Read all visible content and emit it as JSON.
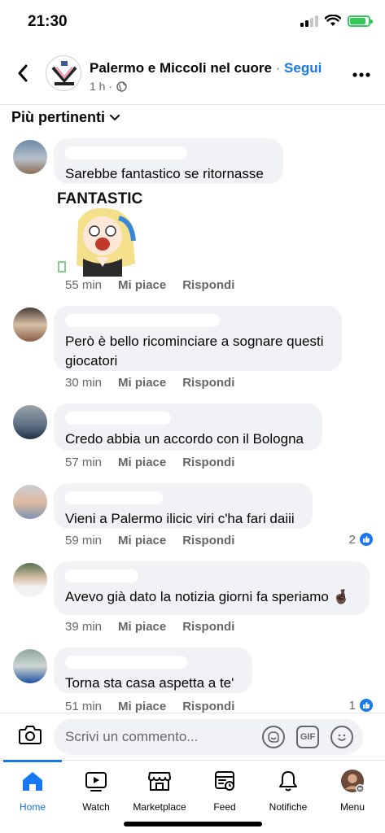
{
  "status_bar": {
    "time": "21:30",
    "icons": [
      "signal-icon",
      "wifi-icon",
      "battery-charging-icon"
    ],
    "battery_color": "#34c759",
    "battery_level": 0.85
  },
  "header": {
    "page_name": "Palermo e Miccoli nel cuore",
    "separator": " · ",
    "follow_label": "Segui",
    "post_age": "1 h ·",
    "back_icon": "chevron-left-icon",
    "more_icon": "more-dots-icon"
  },
  "sort": {
    "label": "Più pertinenti",
    "icon": "chevron-down-icon"
  },
  "comments": [
    {
      "text": "Sarebbe fantastico se ritornasse",
      "sticker_caption": "FANTASTIC",
      "time": "55 min",
      "like_label": "Mi piace",
      "reply_label": "Rispondi"
    },
    {
      "text": "Però è bello ricominciare a sognare questi giocatori",
      "time": "30 min",
      "like_label": "Mi piace",
      "reply_label": "Rispondi"
    },
    {
      "text": "Credo abbia un accordo con il Bologna",
      "time": "57 min",
      "like_label": "Mi piace",
      "reply_label": "Rispondi"
    },
    {
      "text": "Vieni a Palermo ilicic viri c'ha fari daiii",
      "time": "59 min",
      "like_label": "Mi piace",
      "reply_label": "Rispondi",
      "reaction_count": "2"
    },
    {
      "text": "Avevo già dato la notizia giorni fa speriamo 🤞🏿",
      "time": "39 min",
      "like_label": "Mi piace",
      "reply_label": "Rispondi"
    },
    {
      "text": "Torna sta casa aspetta a te'",
      "time": "51 min",
      "like_label": "Mi piace",
      "reply_label": "Rispondi",
      "reaction_count": "1"
    }
  ],
  "composer": {
    "placeholder": "Scrivi un commento...",
    "gif_label": "GIF",
    "icons": [
      "camera-icon",
      "sticker-icon",
      "gif-icon",
      "emoji-icon"
    ]
  },
  "tabbar": {
    "active_color": "#1877f2",
    "tabs": [
      {
        "label": "Home",
        "icon": "home-icon"
      },
      {
        "label": "Watch",
        "icon": "watch-icon"
      },
      {
        "label": "Marketplace",
        "icon": "marketplace-icon"
      },
      {
        "label": "Feed",
        "icon": "feed-icon"
      },
      {
        "label": "Notifiche",
        "icon": "bell-icon"
      },
      {
        "label": "Menu",
        "icon": "profile-avatar-icon"
      }
    ]
  }
}
